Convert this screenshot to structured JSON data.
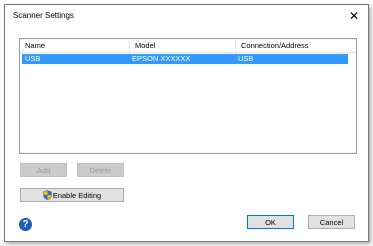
{
  "window": {
    "title": "Scanner Settings",
    "close_glyph": "✕"
  },
  "list": {
    "columns": [
      "Name",
      "Model",
      "Connection/Address"
    ],
    "rows": [
      {
        "name": "USB",
        "model": "EPSON XXXXXX",
        "connection": "USB",
        "selected": true
      }
    ],
    "selection_color": "#3399ff"
  },
  "buttons": {
    "add": "Add",
    "delete": "Delete",
    "enable_editing": "Enable Editing",
    "ok": "OK",
    "cancel": "Cancel",
    "help_glyph": "?"
  },
  "icons": {
    "shield": "shield-icon",
    "help": "help-icon",
    "close": "close-icon"
  }
}
